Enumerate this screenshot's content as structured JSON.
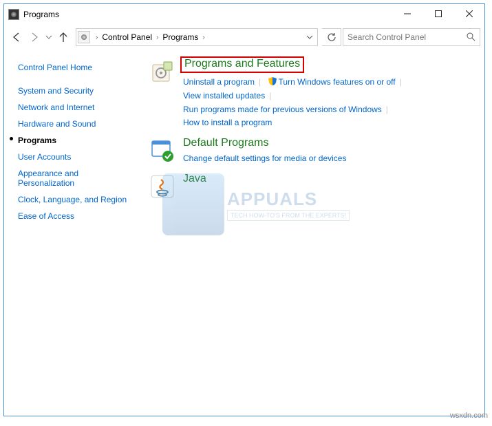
{
  "window": {
    "title": "Programs"
  },
  "breadcrumb": {
    "root": "Control Panel",
    "current": "Programs"
  },
  "search": {
    "placeholder": "Search Control Panel"
  },
  "sidebar": {
    "home": "Control Panel Home",
    "items": [
      "System and Security",
      "Network and Internet",
      "Hardware and Sound",
      "Programs",
      "User Accounts",
      "Appearance and Personalization",
      "Clock, Language, and Region",
      "Ease of Access"
    ],
    "currentIndex": 3
  },
  "sections": {
    "progfeat": {
      "title": "Programs and Features",
      "links": {
        "uninstall": "Uninstall a program",
        "winfeat": "Turn Windows features on or off",
        "updates": "View installed updates",
        "compat": "Run programs made for previous versions of Windows",
        "howto": "How to install a program"
      }
    },
    "defaults": {
      "title": "Default Programs",
      "links": {
        "change": "Change default settings for media or devices"
      }
    },
    "java": {
      "title": "Java"
    }
  },
  "watermark": {
    "big": "APPUALS",
    "small": "TECH HOW-TO'S FROM THE EXPERTS!"
  },
  "attribution": "wsxdn.com"
}
